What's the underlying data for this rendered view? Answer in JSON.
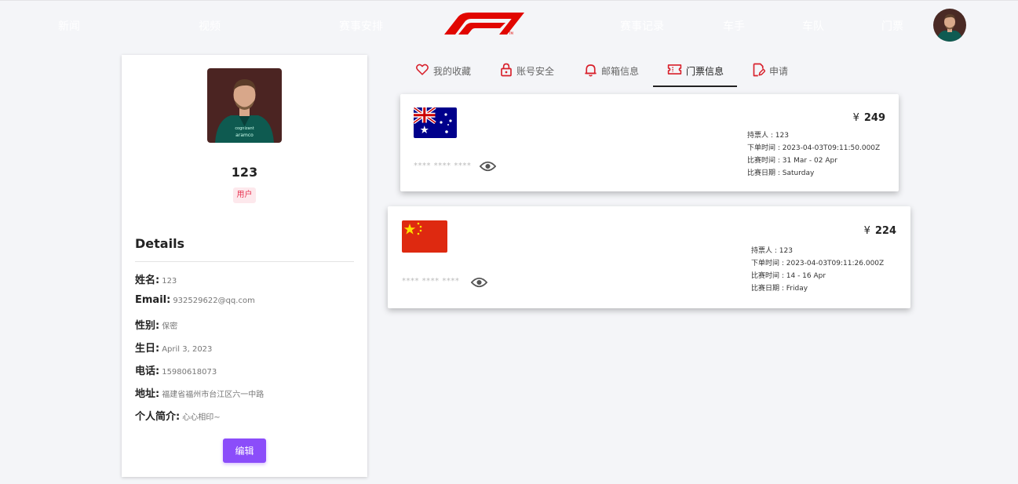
{
  "nav": {
    "items": [
      "新闻",
      "视频",
      "赛事安排",
      "赛事记录",
      "车手",
      "车队",
      "门票"
    ]
  },
  "profile": {
    "name": "123",
    "role": "用户",
    "details_title": "Details",
    "fields": [
      {
        "label": "姓名:",
        "value": "123"
      },
      {
        "label": "Email:",
        "value": "932529622@qq.com"
      },
      {
        "label": "性别:",
        "value": "保密"
      },
      {
        "label": "生日:",
        "value": "April 3, 2023"
      },
      {
        "label": "电话:",
        "value": "15980618073"
      },
      {
        "label": "地址:",
        "value": "福建省福州市台江区六一中路"
      },
      {
        "label": "个人简介:",
        "value": "心心相印~"
      }
    ],
    "edit_label": "编辑"
  },
  "tabs": [
    {
      "label": "我的收藏",
      "icon": "heart-icon"
    },
    {
      "label": "账号安全",
      "icon": "lock-icon"
    },
    {
      "label": "邮箱信息",
      "icon": "bell-icon"
    },
    {
      "label": "门票信息",
      "icon": "ticket-icon",
      "active": true
    },
    {
      "label": "申请",
      "icon": "edit-document-icon"
    }
  ],
  "tickets": [
    {
      "flag": "australia-flag",
      "masked": "**** **** ****",
      "currency": "¥",
      "price": "249",
      "holder": "持票人 : 123",
      "order_time": "下单时间 : 2023-04-03T09:11:50.000Z",
      "race_time": "比赛时间 : 31 Mar - 02 Apr",
      "race_day": "比赛日期 : Saturday"
    },
    {
      "flag": "china-flag",
      "masked": "**** **** ****",
      "currency": "¥",
      "price": "224",
      "holder": "持票人 : 123",
      "order_time": "下单时间 : 2023-04-03T09:11:26.000Z",
      "race_time": "比赛时间 : 14 - 16 Apr",
      "race_day": "比赛日期 : Friday"
    }
  ],
  "colors": {
    "accent": "#8b4dfa",
    "brand_red": "#e10600",
    "tab_icon_red": "#d8202b"
  }
}
